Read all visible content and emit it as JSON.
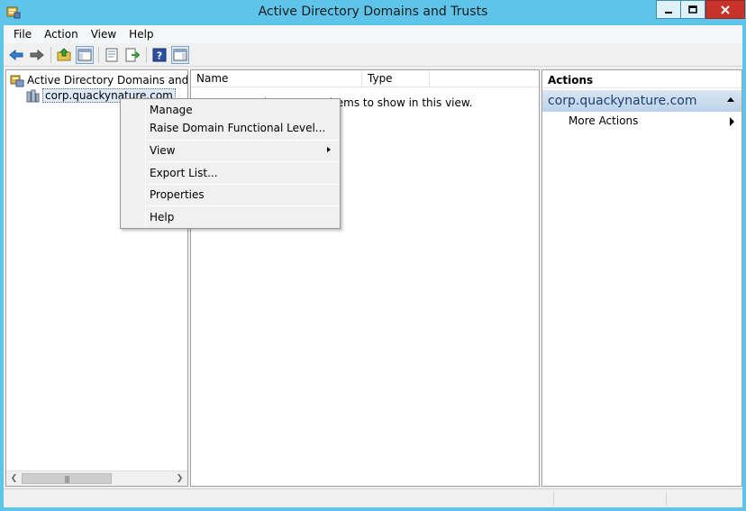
{
  "window": {
    "title": "Active Directory Domains and Trusts"
  },
  "menubar": {
    "items": [
      "File",
      "Action",
      "View",
      "Help"
    ]
  },
  "toolbar": {
    "buttons": [
      "back-icon",
      "forward-icon",
      "up-folder-icon",
      "show-hide-console-tree-icon",
      "properties-icon",
      "export-list-icon",
      "help-icon",
      "show-hide-action-pane-icon"
    ]
  },
  "tree": {
    "root_label": "Active Directory Domains and Trust",
    "child_label": "corp.quackynature.com"
  },
  "list": {
    "columns": [
      "Name",
      "Type"
    ],
    "empty_message": "There are no items to show in this view."
  },
  "actions": {
    "title": "Actions",
    "section_label": "corp.quackynature.com",
    "more_actions": "More Actions"
  },
  "context_menu": {
    "items": [
      "Manage",
      "Raise Domain Functional Level...",
      "View",
      "Export List...",
      "Properties",
      "Help"
    ]
  },
  "colors": {
    "title_bar": "#5fc4ea",
    "close_button": "#c7322b",
    "selection": "#dde9f7",
    "actions_section": "#bcd2ea"
  }
}
